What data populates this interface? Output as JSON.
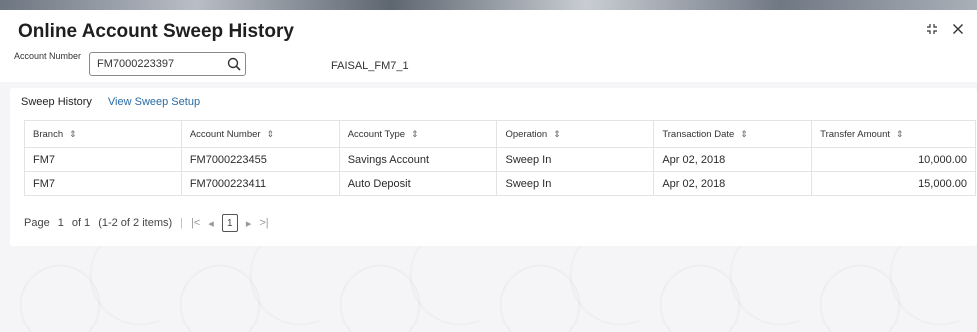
{
  "window": {
    "title": "Online Account Sweep History",
    "icons": [
      "collapse-icon",
      "close-icon"
    ]
  },
  "account": {
    "label": "Account Number",
    "value": "FM7000223397",
    "name": "FAISAL_FM7_1"
  },
  "tabs": [
    {
      "label": "Sweep History",
      "active": true
    },
    {
      "label": "View Sweep Setup",
      "active": false
    }
  ],
  "table": {
    "headers": [
      "Branch",
      "Account Number",
      "Account Type",
      "Operation",
      "Transaction Date",
      "Transfer Amount"
    ],
    "rows": [
      [
        "FM7",
        "FM7000223455",
        "Savings Account",
        "Sweep In",
        "Apr 02, 2018",
        "10,000.00"
      ],
      [
        "FM7",
        "FM7000223411",
        "Auto Deposit",
        "Sweep In",
        "Apr 02, 2018",
        "15,000.00"
      ]
    ]
  },
  "pagination": {
    "page_label": "Page",
    "page": "1",
    "of_label": "of 1",
    "items": "(1-2 of 2 items)",
    "current": "1"
  },
  "colors": {
    "link": "#2a6aa5",
    "background": "#f5f5f7"
  }
}
